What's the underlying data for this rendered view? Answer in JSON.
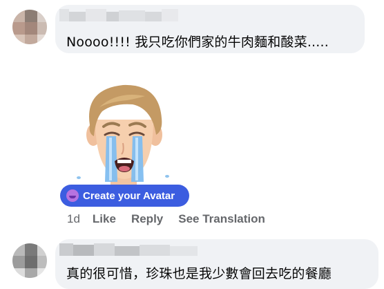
{
  "comments": [
    {
      "text": "Noooo!!!!  我只吃你們家的牛肉麵和酸菜....."
    },
    {
      "sticker": "crying-avatar-sticker",
      "create_avatar_label": "Create your Avatar",
      "time": "1d",
      "actions": {
        "like": "Like",
        "reply": "Reply",
        "see_translation": "See Translation"
      }
    },
    {
      "text": "真的很可惜，珍珠也是我少數會回去吃的餐廳"
    }
  ],
  "colors": {
    "bubble": "#f0f2f5",
    "action_text": "#65676b",
    "create_avatar_button": "#3c5de0"
  }
}
